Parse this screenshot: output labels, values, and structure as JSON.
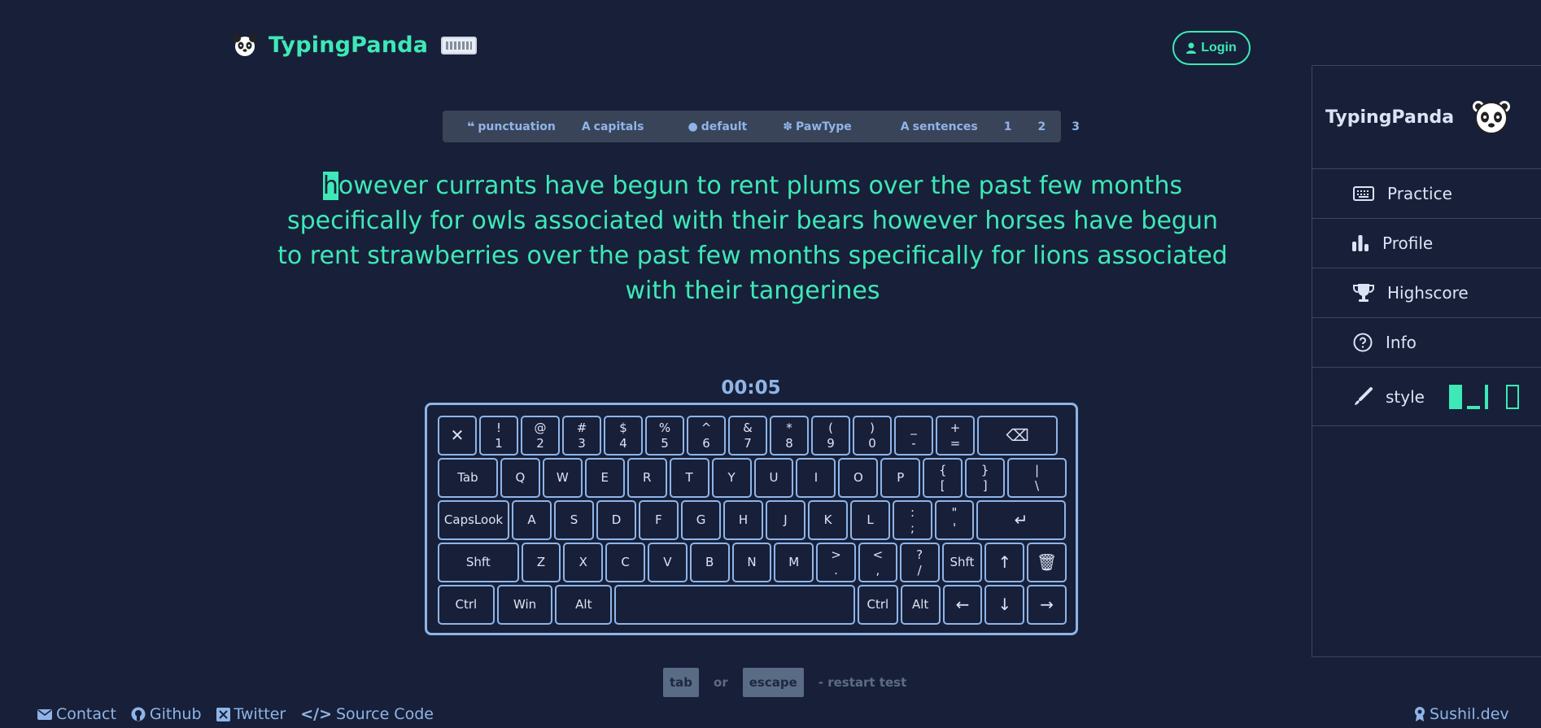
{
  "header": {
    "app_name": "TypingPanda",
    "login_label": "Login"
  },
  "config": {
    "punctuation": "punctuation",
    "capitals": "capitals",
    "theme": "default",
    "pawtype": "PawType",
    "sentences": "sentences",
    "counts": [
      "1",
      "2",
      "3"
    ]
  },
  "test": {
    "caret_char": "h",
    "text": "owever currants have begun to rent plums over the past few months specifically for owls associated with their bears however horses have begun to rent strawberries over the past few months specifically for lions associated with their tangerines",
    "timer": "00:05"
  },
  "keyboard": {
    "rows": [
      [
        [
          "",
          "✕",
          48
        ],
        [
          "!",
          "1",
          48
        ],
        [
          "@",
          "2",
          48
        ],
        [
          "#",
          "3",
          48
        ],
        [
          "$",
          "4",
          48
        ],
        [
          "%",
          "5",
          48
        ],
        [
          "^",
          "6",
          48
        ],
        [
          "&",
          "7",
          48
        ],
        [
          "*",
          "8",
          48
        ],
        [
          "(",
          "9",
          48
        ],
        [
          ")",
          "0",
          48
        ],
        [
          "_",
          "-",
          48
        ],
        [
          "+",
          "=",
          48
        ],
        [
          "",
          "⌫",
          99
        ]
      ],
      [
        [
          "",
          "Tab",
          74
        ],
        [
          "",
          "Q",
          49
        ],
        [
          "",
          "W",
          49
        ],
        [
          "",
          "E",
          49
        ],
        [
          "",
          "R",
          49
        ],
        [
          "",
          "T",
          49
        ],
        [
          "",
          "Y",
          49
        ],
        [
          "",
          "U",
          49
        ],
        [
          "",
          "I",
          49
        ],
        [
          "",
          "O",
          49
        ],
        [
          "",
          "P",
          49
        ],
        [
          "{",
          "[",
          49
        ],
        [
          "}",
          "]",
          49
        ],
        [
          "|",
          "\\",
          73
        ]
      ],
      [
        [
          "",
          "CapsLook",
          88
        ],
        [
          "",
          "A",
          49
        ],
        [
          "",
          "S",
          49
        ],
        [
          "",
          "D",
          49
        ],
        [
          "",
          "F",
          49
        ],
        [
          "",
          "G",
          49
        ],
        [
          "",
          "H",
          49
        ],
        [
          "",
          "J",
          49
        ],
        [
          "",
          "K",
          49
        ],
        [
          "",
          "L",
          49
        ],
        [
          ":",
          ";",
          49
        ],
        [
          "\"",
          "'",
          48
        ],
        [
          "",
          "↵",
          110
        ]
      ],
      [
        [
          "",
          "Shft",
          100
        ],
        [
          "",
          "Z",
          49
        ],
        [
          "",
          "X",
          49
        ],
        [
          "",
          "C",
          49
        ],
        [
          "",
          "V",
          49
        ],
        [
          "",
          "B",
          49
        ],
        [
          "",
          "N",
          49
        ],
        [
          "",
          "M",
          49
        ],
        [
          ">",
          ".",
          49
        ],
        [
          "<",
          ",",
          48
        ],
        [
          "?",
          "/",
          49
        ],
        [
          "",
          "Shft",
          50
        ],
        [
          "",
          "↑",
          49
        ],
        [
          "",
          "🗑",
          49
        ]
      ],
      [
        [
          "",
          "Ctrl",
          70
        ],
        [
          "",
          "Win",
          69
        ],
        [
          "",
          "Alt",
          70
        ],
        [
          "",
          "",
          297
        ],
        [
          "",
          "Ctrl",
          50
        ],
        [
          "",
          "Alt",
          49
        ],
        [
          "",
          "←",
          49
        ],
        [
          "",
          "↓",
          49
        ],
        [
          "",
          "→",
          49
        ]
      ]
    ]
  },
  "hint": {
    "tab": "tab",
    "or": "or",
    "escape": "escape",
    "rest": "- restart test"
  },
  "footer": {
    "contact": "Contact",
    "github": "Github",
    "twitter": "Twitter",
    "source": "Source Code",
    "author": "Sushil.dev"
  },
  "sidebar": {
    "title": "TypingPanda",
    "practice": "Practice",
    "profile": "Profile",
    "highscore": "Highscore",
    "info": "Info",
    "style": "style"
  },
  "colors": {
    "accent": "#3ee8b7",
    "background": "#172038",
    "muted": "#8fb4e8"
  }
}
